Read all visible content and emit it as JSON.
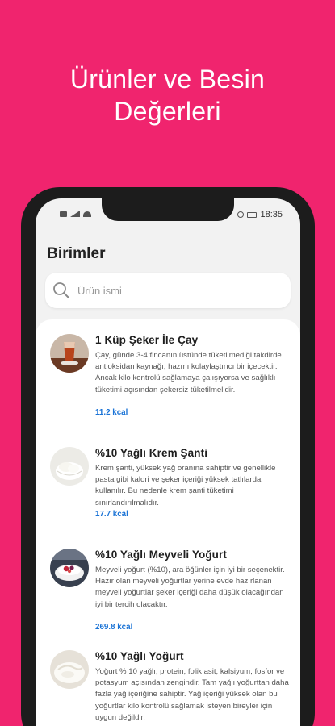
{
  "promo": {
    "title_line1": "Ürünler ve Besin",
    "title_line2": "Değerleri"
  },
  "status_bar": {
    "time": "18:35"
  },
  "page": {
    "title": "Birimler"
  },
  "search": {
    "placeholder": "Ürün ismi"
  },
  "items": [
    {
      "name": "1 Küp Şeker İle Çay",
      "description": "Çay, günde 3-4 fincanın üstünde tüketilmediği takdirde antioksidan kaynağı, hazmı kolaylaştırıcı bir içecektir. Ancak kilo kontrolü sağlamaya çalışıyorsa ve sağlıklı tüketimi açısından şekersiz tüketilmelidir.",
      "kcal": "11.2 kcal",
      "thumb_icon": "tea-glass-photo"
    },
    {
      "name": "%10 Yağlı Krem Şanti",
      "description": "Krem şanti, yüksek yağ oranına sahiptir ve genellikle pasta gibi kalori ve şeker içeriği yüksek tatlılarda kullanılır. Bu nedenle krem şanti tüketimi sınırlandırılmalıdır.",
      "kcal": "17.7 kcal",
      "thumb_icon": "whipped-cream-photo"
    },
    {
      "name": "%10 Yağlı Meyveli Yoğurt",
      "description": "Meyveli yoğurt (%10), ara öğünler için iyi bir seçenektir. Hazır olan meyveli yoğurtlar yerine evde hazırlanan meyveli yoğurtlar şeker içeriği daha düşük olacağından iyi bir tercih olacaktır.",
      "kcal": "269.8 kcal",
      "thumb_icon": "fruit-yogurt-photo"
    },
    {
      "name": "%10 Yağlı Yoğurt",
      "description": "Yoğurt % 10 yağlı, protein, folik asit, kalsiyum, fosfor ve potasyum açısından zengindir. Tam yağlı yoğurttan daha fazla yağ içeriğine sahiptir. Yağ içeriği yüksek olan bu yoğurtlar kilo kontrolü sağlamak isteyen bireyler için uygun değildir.",
      "kcal": "",
      "thumb_icon": "yogurt-photo"
    }
  ],
  "colors": {
    "background": "#f0246e",
    "kcal": "#1a73d6",
    "phone_frame": "#1c1c1c"
  }
}
